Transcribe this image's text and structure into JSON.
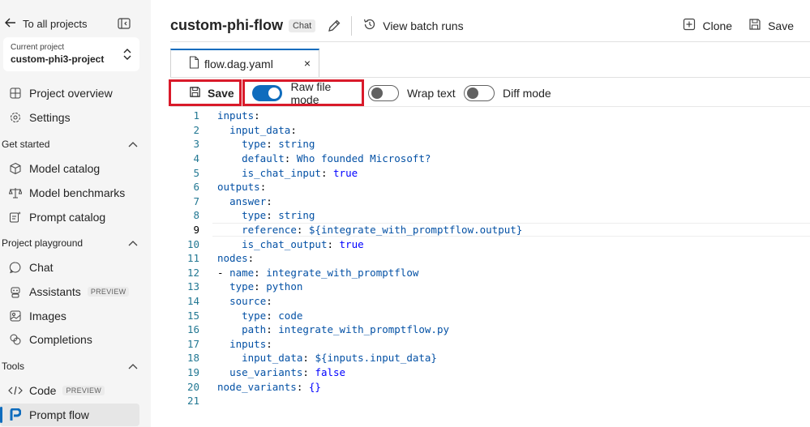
{
  "sidebar": {
    "back_label": "To all projects",
    "current_project_label": "Current project",
    "current_project_name": "custom-phi3-project",
    "items_top": [
      {
        "label": "Project overview",
        "icon": "grid-icon"
      },
      {
        "label": "Settings",
        "icon": "gear-icon"
      }
    ],
    "sections": [
      {
        "title": "Get started",
        "items": [
          {
            "label": "Model catalog",
            "icon": "cube-icon"
          },
          {
            "label": "Model benchmarks",
            "icon": "scale-icon"
          },
          {
            "label": "Prompt catalog",
            "icon": "sparkle-list-icon"
          }
        ]
      },
      {
        "title": "Project playground",
        "items": [
          {
            "label": "Chat",
            "icon": "chat-icon"
          },
          {
            "label": "Assistants",
            "icon": "bot-icon",
            "badge": "PREVIEW"
          },
          {
            "label": "Images",
            "icon": "image-icon"
          },
          {
            "label": "Completions",
            "icon": "completions-icon"
          }
        ]
      },
      {
        "title": "Tools",
        "items": [
          {
            "label": "Code",
            "icon": "code-icon",
            "badge": "PREVIEW"
          },
          {
            "label": "Prompt flow",
            "icon": "promptflow-icon",
            "active": true
          }
        ]
      }
    ]
  },
  "header": {
    "title": "custom-phi-flow",
    "chip": "Chat",
    "view_batch_runs": "View batch runs",
    "clone": "Clone",
    "save": "Save"
  },
  "tab": {
    "label": "flow.dag.yaml",
    "close": "×"
  },
  "toolbar": {
    "save": "Save",
    "raw_file_mode": "Raw file mode",
    "raw_file_mode_on": true,
    "wrap_text": "Wrap text",
    "wrap_text_on": false,
    "diff_mode": "Diff mode",
    "diff_mode_on": false
  },
  "editor": {
    "current_line": 9,
    "lines": [
      "inputs:",
      "  input_data:",
      "    type: string",
      "    default: Who founded Microsoft?",
      "    is_chat_input: true",
      "outputs:",
      "  answer:",
      "    type: string",
      "    reference: ${integrate_with_promptflow.output}",
      "    is_chat_output: true",
      "nodes:",
      "- name: integrate_with_promptflow",
      "  type: python",
      "  source:",
      "    type: code",
      "    path: integrate_with_promptflow.py",
      "  inputs:",
      "    input_data: ${inputs.input_data}",
      "  use_variants: false",
      "node_variants: {}",
      ""
    ]
  },
  "colors": {
    "accent": "#0f6cbd",
    "highlight_border": "#d91a2a",
    "yaml_key": "#0451a5",
    "yaml_value": "#0000ff",
    "line_number": "#237893"
  }
}
